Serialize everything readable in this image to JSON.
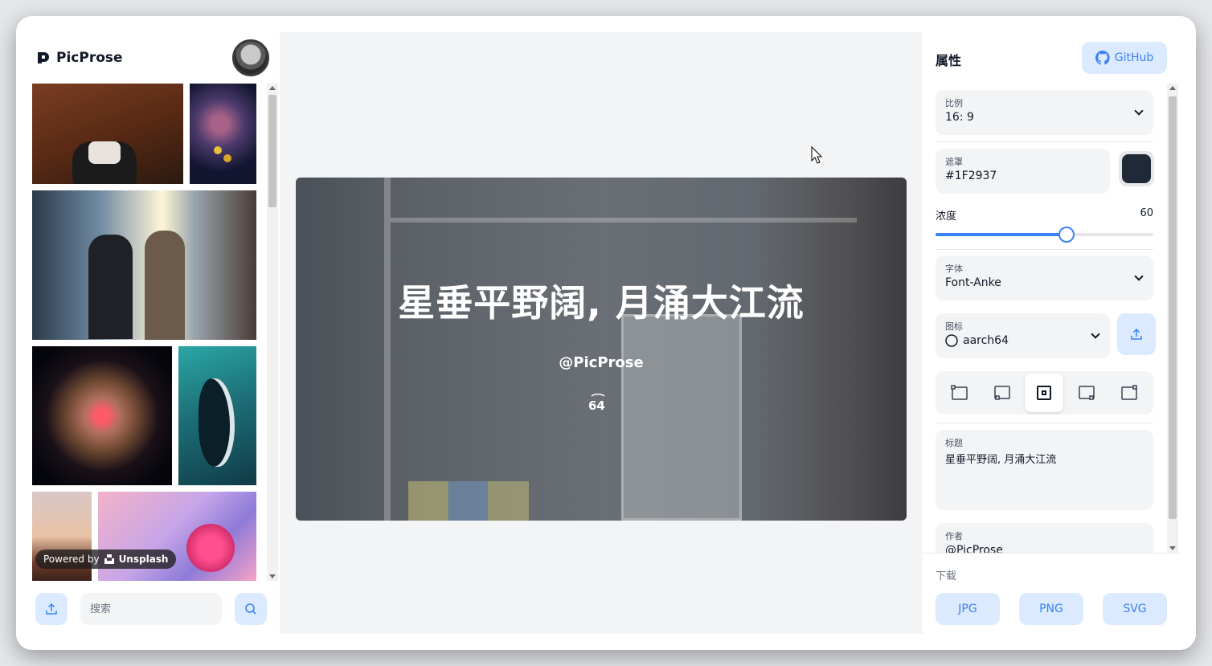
{
  "app": {
    "name": "PicProse"
  },
  "sidebar": {
    "powered_by": "Powered by",
    "unsplash": "Unsplash",
    "search_placeholder": "搜索"
  },
  "preview": {
    "title": "星垂平野阔, 月涌大江流",
    "author": "@PicProse",
    "icon_text": "64",
    "overlay_color": "#1F2937",
    "overlay_opacity_percent": 60
  },
  "properties": {
    "heading": "属性",
    "github_label": "GitHub",
    "ratio": {
      "label": "比例",
      "value": "16: 9"
    },
    "mask": {
      "label": "遮罩",
      "value": "#1F2937",
      "color": "#1F2937"
    },
    "opacity": {
      "label": "浓度",
      "value": "60",
      "fraction": 0.6
    },
    "font": {
      "label": "字体",
      "value": "Font-Anke"
    },
    "icon": {
      "label": "图标",
      "value": "aarch64"
    },
    "title_field": {
      "label": "标题",
      "value": "星垂平野阔, 月涌大江流"
    },
    "author_field": {
      "label": "作者",
      "value": "@PicProse"
    }
  },
  "download": {
    "label": "下载",
    "jpg": "JPG",
    "png": "PNG",
    "svg": "SVG"
  },
  "colors": {
    "accent": "#3B82F6",
    "accent_bg": "#DBEAFE",
    "canvas_bg": "#F3F4F6"
  }
}
